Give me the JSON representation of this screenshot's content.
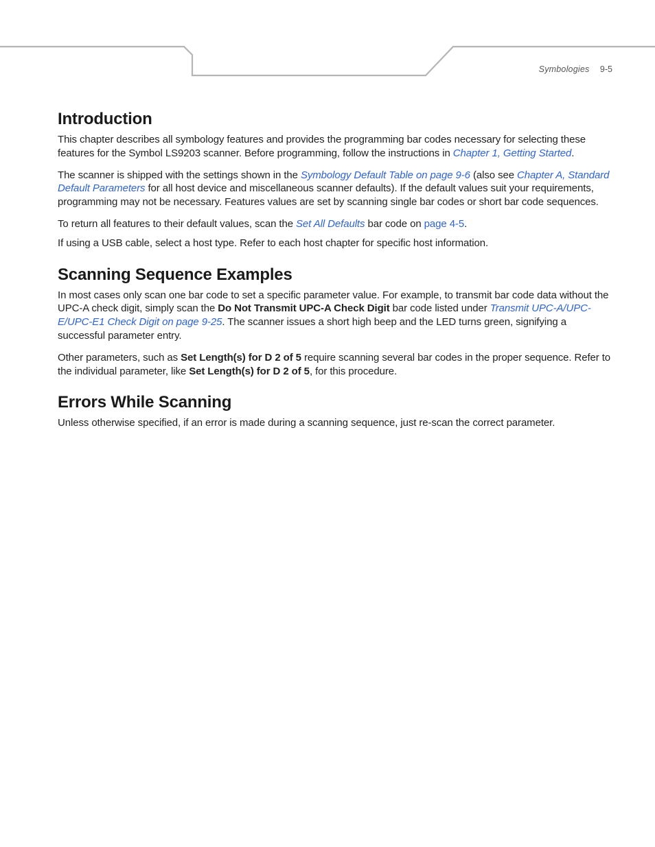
{
  "header": {
    "chapter": "Symbologies",
    "pagenum": "9-5"
  },
  "s1": {
    "title": "Introduction",
    "p1a": "This chapter describes all symbology features and provides the programming bar codes necessary for selecting these features for the Symbol  LS9203 scanner. Before programming, follow the instructions in ",
    "p1link": "Chapter 1, Getting Started",
    "p1b": ".",
    "p2a": "The scanner is shipped with the settings shown in the ",
    "p2link1": "Symbology Default Table on page 9-6",
    "p2b": " (also see ",
    "p2link2": "Chapter A, Standard Default Parameters",
    "p2c": " for all host device and miscellaneous scanner defaults). If the default values suit your requirements, programming may not be necessary. Features values are set by scanning single bar codes or short bar code sequences.",
    "p3a": "To return all features to their default values, scan the ",
    "p3link": "Set All Defaults",
    "p3b": " bar code on ",
    "p3link2": "page 4-5",
    "p3c": ".",
    "p4": "If using a USB cable, select a host type. Refer to each host chapter for specific host information."
  },
  "s2": {
    "title": "Scanning Sequence Examples",
    "p1a": "In most cases only scan one bar code to set a specific parameter value. For example, to transmit bar code data without the UPC-A check digit, simply scan the ",
    "p1bold": "Do Not Transmit UPC-A Check Digit",
    "p1b": " bar code listed under ",
    "p1link": "Transmit UPC-A/UPC-E/UPC-E1 Check Digit on page 9-25",
    "p1c": ". The scanner issues a short high beep and the LED turns green, signifying a successful parameter entry.",
    "p2a": "Other parameters, such as ",
    "p2bold1": "Set Length(s) for D 2 of 5",
    "p2b": " require scanning several bar codes in the proper sequence. Refer to the individual parameter, like ",
    "p2bold2": "Set Length(s) for D 2 of 5",
    "p2c": ", for this procedure."
  },
  "s3": {
    "title": "Errors While Scanning",
    "p1": "Unless otherwise specified, if an error is made during a scanning sequence, just re-scan the correct parameter."
  }
}
